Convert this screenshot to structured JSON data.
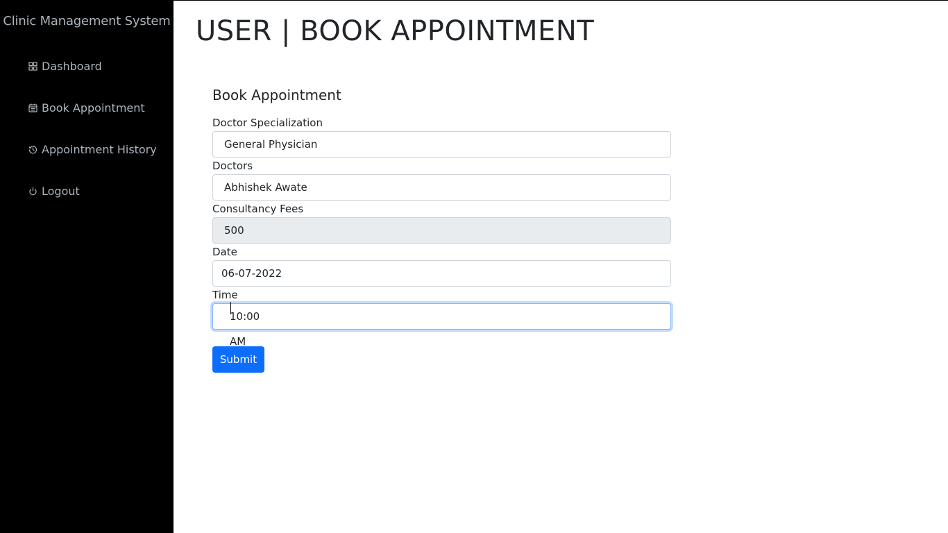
{
  "sidebar": {
    "brand": "Clinic Management System",
    "items": [
      {
        "label": "Dashboard",
        "icon": "grid-icon"
      },
      {
        "label": "Book Appointment",
        "icon": "calendar-icon"
      },
      {
        "label": "Appointment History",
        "icon": "history-icon"
      },
      {
        "label": "Logout",
        "icon": "power-icon"
      }
    ]
  },
  "header": {
    "title": "USER | BOOK APPOINTMENT"
  },
  "form": {
    "title": "Book Appointment",
    "specialization": {
      "label": "Doctor Specialization",
      "value": "General Physician"
    },
    "doctor": {
      "label": "Doctors",
      "value": "Abhishek Awate"
    },
    "fees": {
      "label": "Consultancy Fees",
      "value": "500"
    },
    "date": {
      "label": "Date",
      "value": "06-07-2022"
    },
    "time": {
      "label": "Time",
      "value": "10:00 AM"
    },
    "submit_label": "Submit"
  },
  "colors": {
    "sidebar_bg": "#000000",
    "sidebar_text": "#adb5bd",
    "primary": "#0d6efd",
    "readonly_bg": "#e9ecef",
    "focus_border": "#86b7fe"
  }
}
